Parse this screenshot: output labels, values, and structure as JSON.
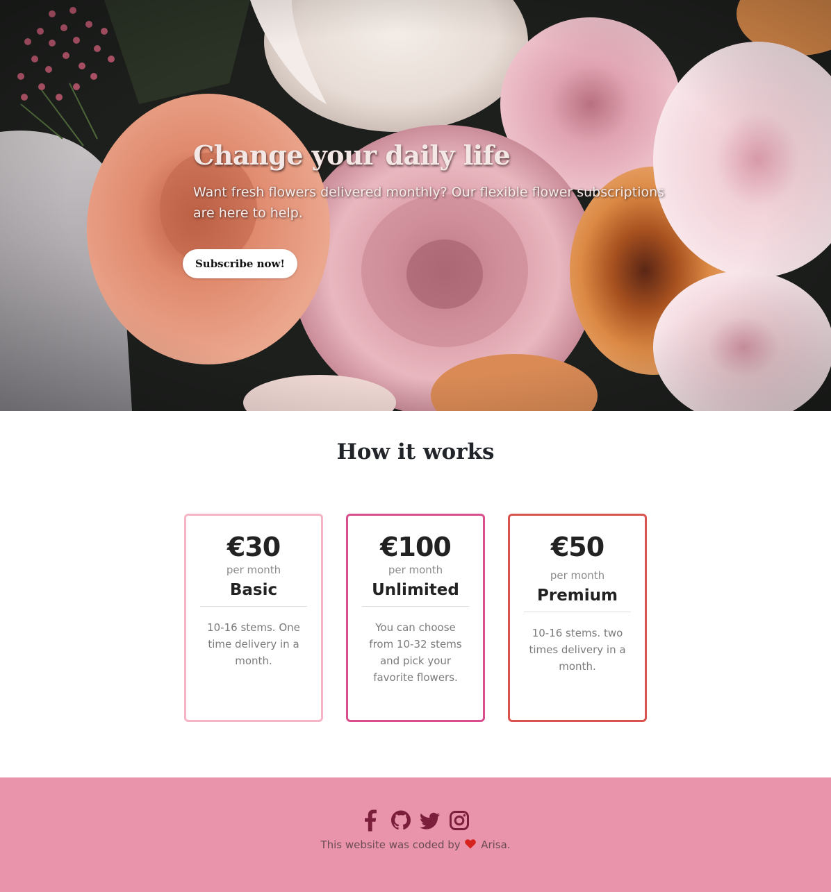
{
  "hero": {
    "title": "Change your daily life",
    "subtitle": "Want fresh flowers delivered monthly? Our flexible flower subscriptions are here to help.",
    "cta_label": "Subscribe now!",
    "background_icon": "flower-bouquet-photo"
  },
  "how_it_works": {
    "title": "How it works",
    "plans": [
      {
        "price": "€30",
        "period": "per month",
        "name": "Basic",
        "description": "10-16 stems. One time delivery in a month.",
        "border_color": "#f5b5c6"
      },
      {
        "price": "€100",
        "period": "per month",
        "name": "Unlimited",
        "description": "You can choose from 10-32 stems and pick your favorite flowers.",
        "border_color": "#d94f8e"
      },
      {
        "price": "€50",
        "period": "per month",
        "name": "Premium",
        "description": "10-16 stems. two times delivery in a month.",
        "border_color": "#d9534f"
      }
    ]
  },
  "footer": {
    "social_icons": [
      "facebook-icon",
      "github-icon",
      "twitter-icon",
      "instagram-icon"
    ],
    "credit_prefix": "This website was coded by",
    "credit_suffix": "Arisa.",
    "background_color": "#e994aa",
    "icon_color": "#7a1e3c",
    "heart_color": "#d6231d"
  }
}
